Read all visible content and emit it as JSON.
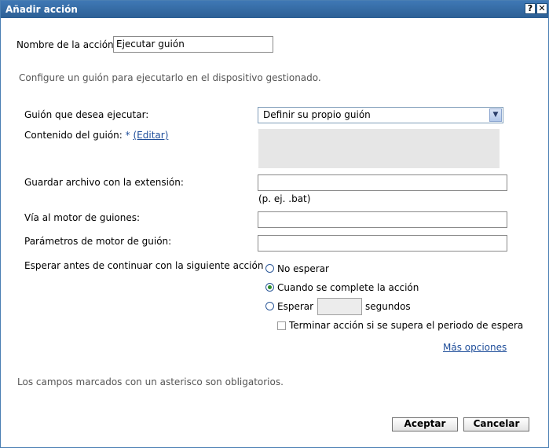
{
  "dialog": {
    "title": "Añadir acción",
    "help_symbol": "?",
    "close_symbol": "✕"
  },
  "form": {
    "action_name_label": "Nombre de la acción",
    "action_name_value": "Ejecutar guión",
    "description": "Configure un guión para ejecutarlo en el dispositivo gestionado.",
    "script_select_label": "Guión que desea ejecutar:",
    "script_select_value": "Definir su propio guión",
    "script_content_label": "Contenido del guión:",
    "required_marker": "*",
    "edit_link": "(Editar)",
    "save_ext_label": "Guardar archivo con la extensión:",
    "save_ext_value": "",
    "save_ext_hint": "(p. ej. .bat)",
    "engine_path_label": "Vía al motor de guiones:",
    "engine_path_value": "",
    "engine_params_label": "Parámetros de motor de guión:",
    "engine_params_value": "",
    "wait_label": "Esperar antes de continuar con la siguiente acción",
    "wait_options": [
      {
        "label": "No esperar",
        "checked": false
      },
      {
        "label": "Cuando se complete la acción",
        "checked": true
      },
      {
        "label": "Esperar",
        "checked": false
      }
    ],
    "wait_seconds_value": "",
    "seconds_label": "segundos",
    "terminate_label": "Terminar acción si se supera el periodo de espera",
    "terminate_checked": false,
    "more_options_link": "Más opciones",
    "footer_note": "Los campos marcados con un asterisco son obligatorios."
  },
  "buttons": {
    "accept": "Aceptar",
    "cancel": "Cancelar"
  },
  "colors": {
    "titlebar": "#336699",
    "link": "#1f4e9a",
    "radio_checked": "#2a8a2a"
  },
  "icons": {
    "help": "question-mark-icon",
    "close": "close-icon",
    "dropdown": "chevron-down-icon"
  }
}
